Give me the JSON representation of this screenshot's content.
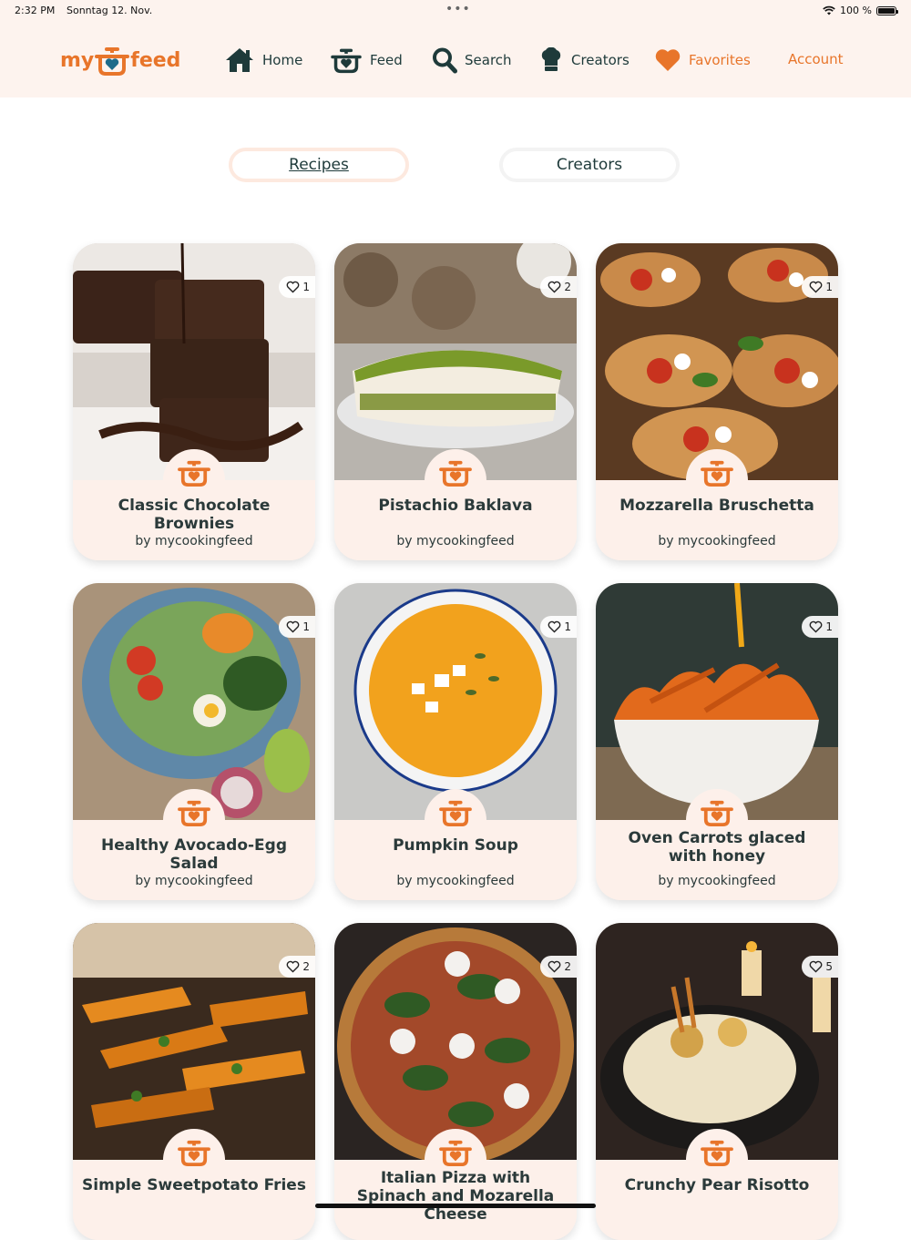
{
  "status_bar": {
    "time": "2:32 PM",
    "date": "Sonntag 12. Nov.",
    "dots": "•••",
    "battery": "100 %"
  },
  "nav": {
    "logo_left": "my",
    "logo_right": "feed",
    "home": "Home",
    "feed": "Feed",
    "search": "Search",
    "creators": "Creators",
    "favorites": "Favorites",
    "account": "Account"
  },
  "tabs": {
    "recipes": "Recipes",
    "creators": "Creators"
  },
  "recipes": [
    {
      "title": "Classic Chocolate Brownies",
      "author": "by mycookingfeed",
      "likes": "1"
    },
    {
      "title": "Pistachio Baklava",
      "author": "by mycookingfeed",
      "likes": "2"
    },
    {
      "title": "Mozzarella Bruschetta",
      "author": "by mycookingfeed",
      "likes": "1"
    },
    {
      "title": "Healthy Avocado-Egg Salad",
      "author": "by mycookingfeed",
      "likes": "1"
    },
    {
      "title": "Pumpkin Soup",
      "author": "by mycookingfeed",
      "likes": "1"
    },
    {
      "title": "Oven Carrots glaced with honey",
      "author": "by mycookingfeed",
      "likes": "1"
    },
    {
      "title": "Simple Sweetpotato Fries",
      "author": "",
      "likes": "2"
    },
    {
      "title": "Italian Pizza with Spinach and Mozarella Cheese",
      "author": "",
      "likes": "2"
    },
    {
      "title": "Crunchy Pear Risotto",
      "author": "",
      "likes": "5"
    }
  ],
  "colors": {
    "accent": "#e8752a",
    "dark": "#1e3a3a",
    "card_bg": "#fdf0ea"
  }
}
